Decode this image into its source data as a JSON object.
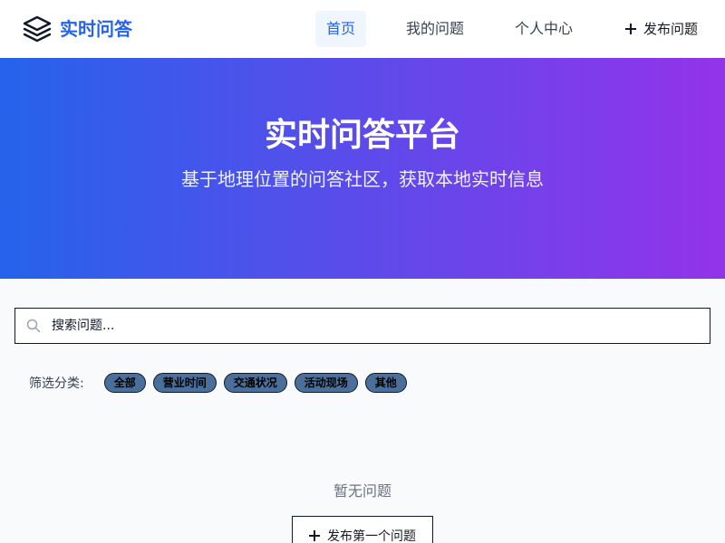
{
  "brand": {
    "name": "实时问答",
    "icon": "layers-icon",
    "color": "#2563eb"
  },
  "nav": {
    "home": "首页",
    "my_questions": "我的问题",
    "profile": "个人中心",
    "post_question": "发布问题",
    "post_icon": "plus-icon"
  },
  "hero": {
    "title": "实时问答平台",
    "subtitle": "基于地理位置的问答社区，获取本地实时信息",
    "gradient_start": "#2563eb",
    "gradient_end": "#9333ea"
  },
  "search": {
    "placeholder": "搜索问题...",
    "value": "",
    "icon": "search-icon"
  },
  "filter": {
    "label": "筛选分类:",
    "chips": [
      "全部",
      "营业时间",
      "交通状况",
      "活动现场",
      "其他"
    ]
  },
  "empty": {
    "message": "暂无问题",
    "button_label": "发布第一个问题",
    "button_icon": "plus-icon"
  }
}
